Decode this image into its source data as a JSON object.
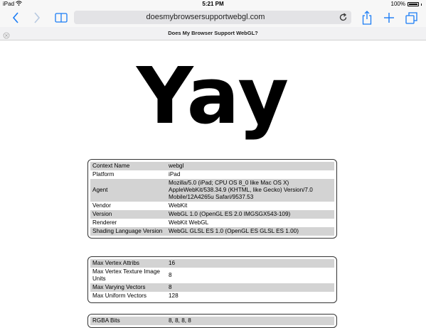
{
  "status": {
    "device": "iPad",
    "time": "5:21 PM",
    "battery": "100%"
  },
  "toolbar": {
    "url": "doesmybrowsersupportwebgl.com"
  },
  "tab": {
    "title": "Does My Browser Support WebGL?"
  },
  "headline": "Yay",
  "table1": [
    {
      "k": "Context Name",
      "v": "webgl"
    },
    {
      "k": "Platform",
      "v": "iPad"
    },
    {
      "k": "Agent",
      "v": "Mozilla/5.0 (iPad; CPU OS 8_0 like Mac OS X) AppleWebKit/538.34.9 (KHTML, like Gecko) Version/7.0 Mobile/12A4265u Safari/9537.53"
    },
    {
      "k": "Vendor",
      "v": "WebKit"
    },
    {
      "k": "Version",
      "v": "WebGL 1.0 (OpenGL ES 2.0 IMGSGX543-109)"
    },
    {
      "k": "Renderer",
      "v": "WebKit WebGL"
    },
    {
      "k": "Shading Language Version",
      "v": "WebGL GLSL ES 1.0 (OpenGL ES GLSL ES 1.00)"
    }
  ],
  "table2": [
    {
      "k": "Max Vertex Attribs",
      "v": "16"
    },
    {
      "k": "Max Vertex Texture Image Units",
      "v": "8"
    },
    {
      "k": "Max Varying Vectors",
      "v": "8"
    },
    {
      "k": "Max Uniform Vectors",
      "v": "128"
    }
  ],
  "table3": [
    {
      "k": "RGBA Bits",
      "v": "8, 8, 8, 8"
    }
  ]
}
